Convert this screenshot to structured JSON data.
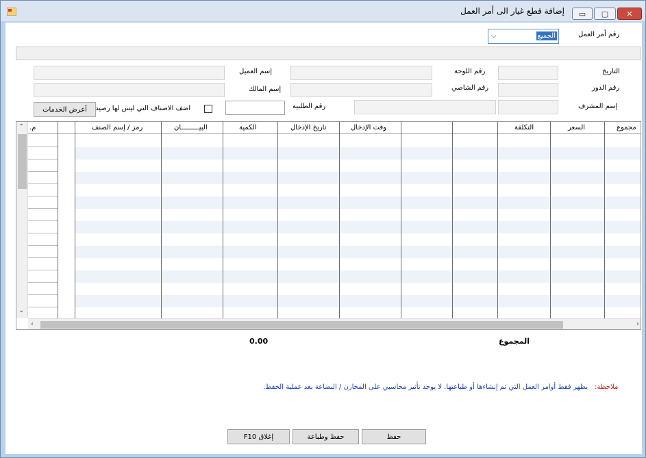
{
  "window": {
    "title": "إضافة قطع غيار الى أمر العمل",
    "min_label": "▭",
    "max_label": "▢",
    "close_label": "✕"
  },
  "work_order": {
    "label": "رقم أمر العمل",
    "value": "الجميع"
  },
  "fields": {
    "date_label": "التاريخ",
    "plate_label": "رقم اللوحة",
    "customer_label": "إسم العميل",
    "role_label": "رقم الدور",
    "chassis_label": "رقم الشاصي",
    "owner_label": "إسم المالك",
    "supervisor_label": "إسم المشرف",
    "request_label": "رقم الطلبية"
  },
  "options": {
    "add_items_label": "اضف الاصناف التي ليس لها رصيد",
    "show_services_label": "أعرض الخدمات"
  },
  "grid": {
    "columns": [
      "مجموع",
      "السعر",
      "التكلفة",
      "",
      "",
      "وقت الإدخال",
      "تاريخ الإدخال",
      "الكمية",
      "البيـــــــــان",
      "رمز / إسم الصنف",
      "",
      "م."
    ]
  },
  "totals": {
    "label": "المجموع",
    "value": "0.00"
  },
  "note": {
    "label": "ملاحظة:",
    "text": "يظهر فقط أوامر العمل التي تم إنشاءها أو طباعتها. لا يوجد تأثير محاسبي على المخازن / البضاعة بعد عملية الحفظ."
  },
  "buttons": {
    "save": "حفظ",
    "save_print": "حفظ وطباعة",
    "close": "إغلاق F10"
  },
  "colors": {
    "accent": "#3072c7",
    "note_label": "#d21818",
    "note_text": "#1a3fb8"
  }
}
